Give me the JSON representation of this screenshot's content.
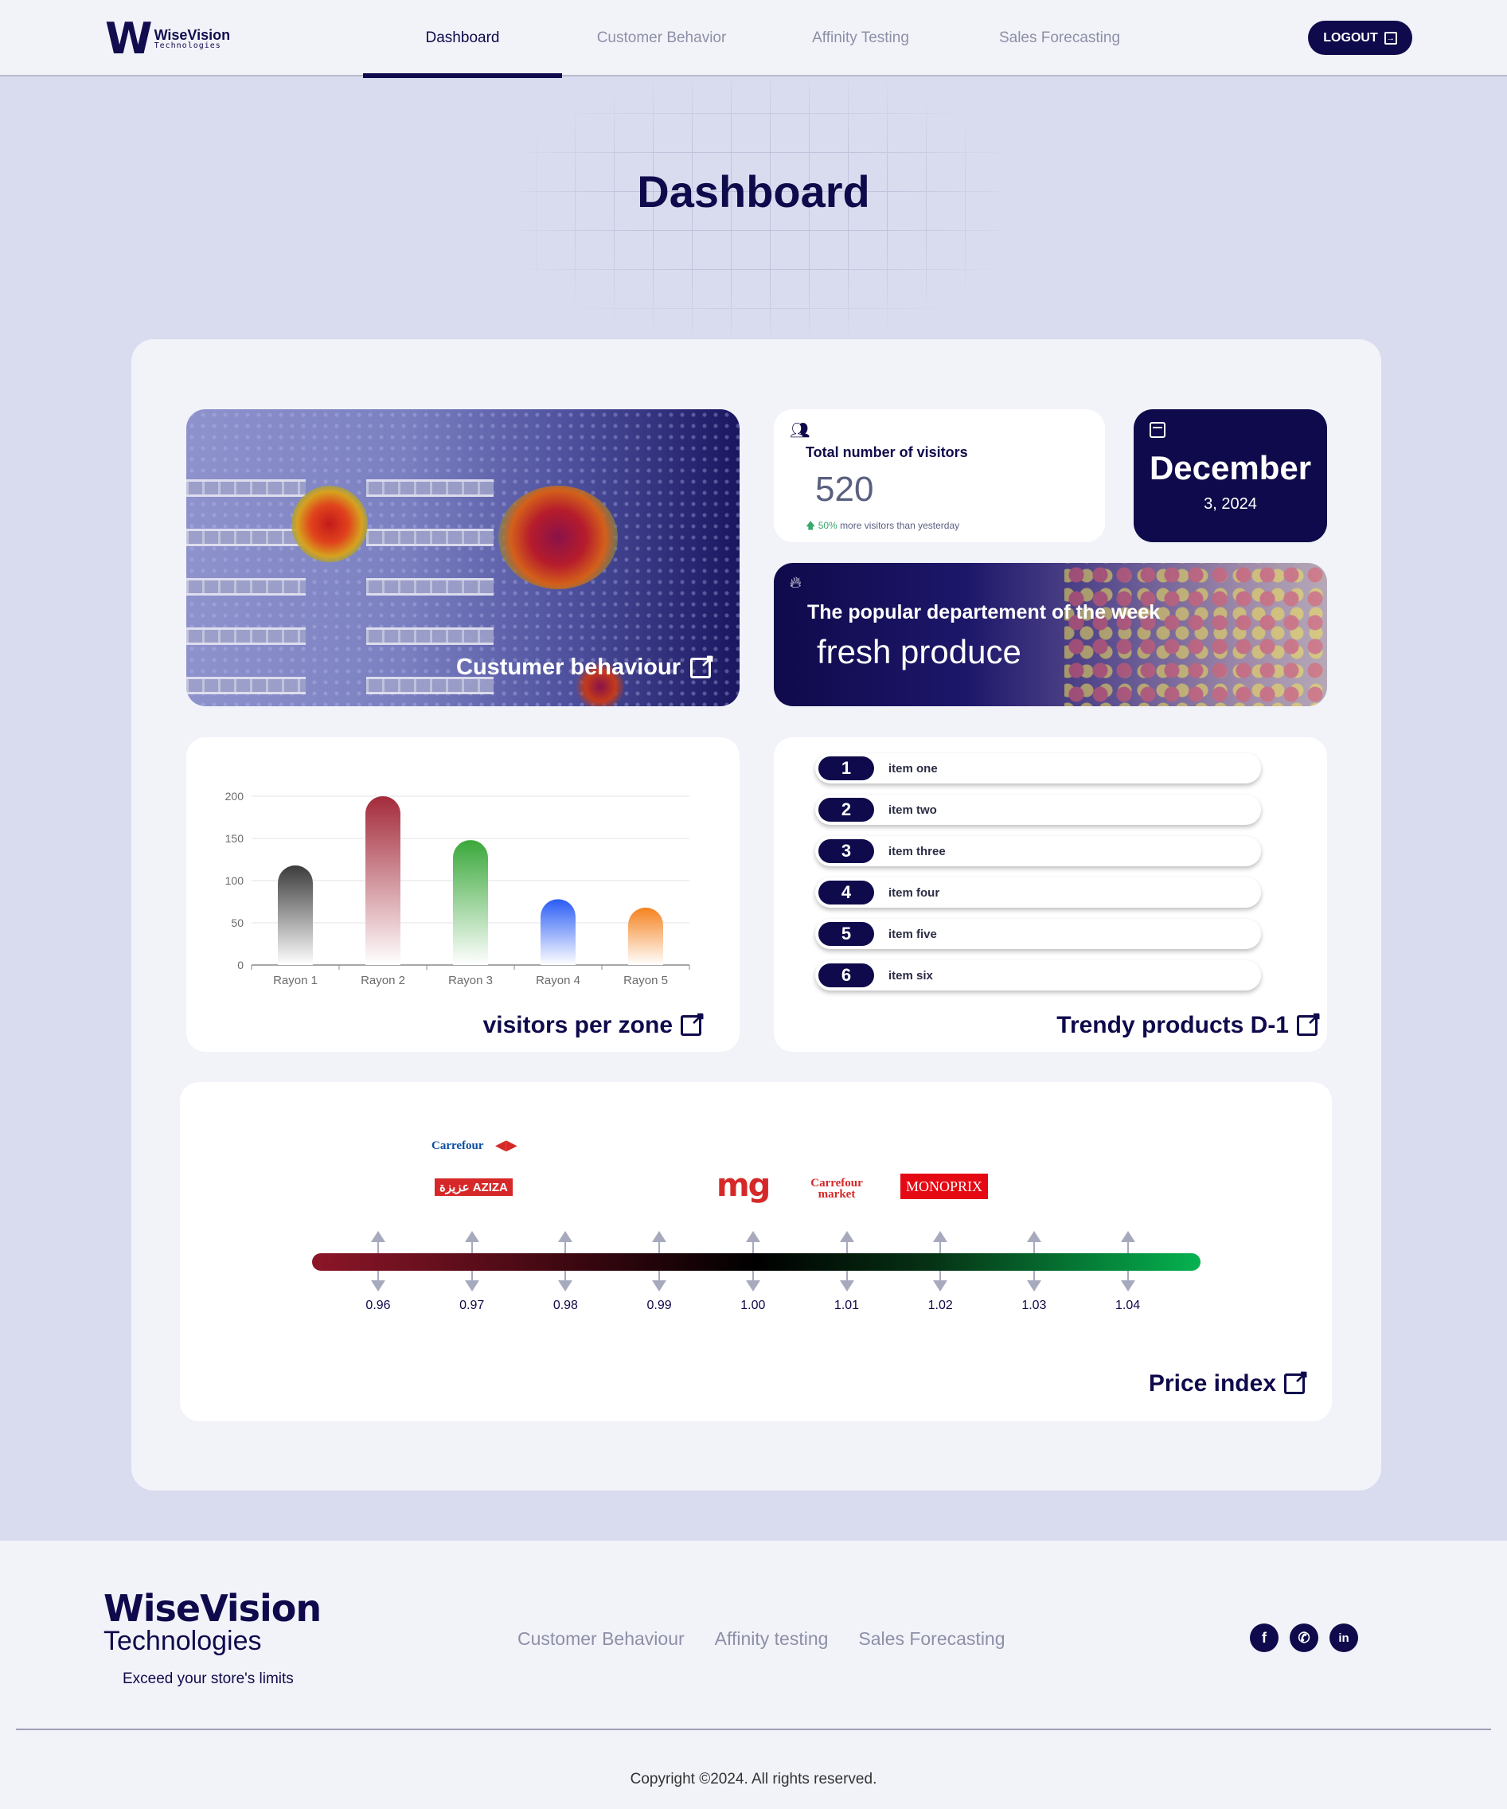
{
  "header": {
    "logo_name": "WiseVision",
    "logo_sub": "Technologies",
    "nav": [
      {
        "label": "Dashboard",
        "active": true
      },
      {
        "label": "Customer Behavior",
        "active": false
      },
      {
        "label": "Affinity Testing",
        "active": false
      },
      {
        "label": "Sales Forecasting",
        "active": false
      }
    ],
    "logout_label": "LOGOUT"
  },
  "page_title": "Dashboard",
  "heatmap_card": {
    "label": "Custumer behaviour",
    "icon": "external-link-icon"
  },
  "visitors_card": {
    "icon": "people-icon",
    "title": "Total number of visitors",
    "value": "520",
    "delta_percent": "50%",
    "delta_text": "more visitors than yesterday"
  },
  "date_card": {
    "icon": "calendar-icon",
    "month": "December",
    "day": "3, 2024"
  },
  "popular_card": {
    "icon": "fire-icon",
    "title": "The popular departement of the week",
    "value": "fresh produce"
  },
  "visitors_per_zone": {
    "label": "visitors per zone",
    "chart_data": {
      "type": "bar",
      "categories": [
        "Rayon 1",
        "Rayon 2",
        "Rayon 3",
        "Rayon 4",
        "Rayon 5"
      ],
      "values": [
        118,
        200,
        148,
        78,
        68
      ],
      "ylim": [
        0,
        200
      ],
      "yticks": [
        "0",
        "50",
        "100",
        "150",
        "200"
      ],
      "colors": [
        "#3b3b3b",
        "#a32a3a",
        "#3aa83a",
        "#2a5cf5",
        "#f5821f"
      ],
      "grid": true
    }
  },
  "trendy_card": {
    "label": "Trendy products D-1",
    "items": [
      {
        "rank": "1",
        "name": "item one"
      },
      {
        "rank": "2",
        "name": "item two"
      },
      {
        "rank": "3",
        "name": "item three"
      },
      {
        "rank": "4",
        "name": "item four"
      },
      {
        "rank": "5",
        "name": "item five"
      },
      {
        "rank": "6",
        "name": "item six"
      }
    ]
  },
  "price_index": {
    "label": "Price index",
    "brands": [
      "Carrefour",
      "عزيزة AZIZA",
      "mg",
      "Carrefour market",
      "MONOPRIX"
    ],
    "ticks": [
      "0.96",
      "0.97",
      "0.98",
      "0.99",
      "1.00",
      "1.01",
      "1.02",
      "1.03",
      "1.04"
    ]
  },
  "footer": {
    "brand": "WiseVision",
    "sub": "Technologies",
    "tagline": "Exceed your store's limits",
    "links": [
      "Customer Behaviour",
      "Affinity testing",
      "Sales Forecasting"
    ],
    "social": [
      "facebook-icon",
      "whatsapp-icon",
      "linkedin-icon"
    ],
    "copyright": "Copyright ©2024. All rights reserved."
  }
}
